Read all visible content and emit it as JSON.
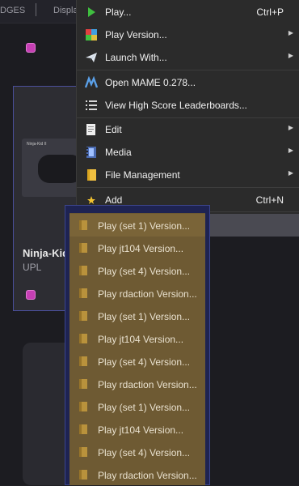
{
  "toolbar": {
    "badges_tab": "DGES",
    "display_tab": "Displa"
  },
  "game_card": {
    "title": "Ninja-Kid II",
    "publisher": "UPL",
    "thumb_title": "Ninja-Kid II"
  },
  "context_menu": {
    "items": [
      {
        "label": "Play...",
        "shortcut": "Ctrl+P",
        "icon": "play-icon"
      },
      {
        "label": "Play Version...",
        "icon": "play-version-icon"
      },
      {
        "label": "Launch With...",
        "icon": "paper-plane-icon"
      },
      {
        "label": "Open MAME 0.278...",
        "icon": "mame-icon"
      },
      {
        "label": "View High Score Leaderboards...",
        "icon": "list-icon"
      },
      {
        "label": "Edit",
        "icon": "edit-icon"
      },
      {
        "label": "Media",
        "icon": "film-icon"
      },
      {
        "label": "File Management",
        "icon": "folder-icon"
      },
      {
        "label": "Add",
        "shortcut": "Ctrl+N",
        "icon": "star-icon"
      }
    ]
  },
  "version_list": [
    "Play (set 1) Version...",
    "Play jt104 Version...",
    "Play (set 4) Version...",
    "Play rdaction Version...",
    "Play (set 1) Version...",
    "Play jt104 Version...",
    "Play (set 4) Version...",
    "Play rdaction Version...",
    "Play (set 1) Version...",
    "Play jt104 Version...",
    "Play (set 4) Version...",
    "Play rdaction Version..."
  ],
  "colors": {
    "accent": "#3c458d",
    "submenu_bg": "#6e5a33",
    "menu_bg": "#2b2b2b"
  }
}
